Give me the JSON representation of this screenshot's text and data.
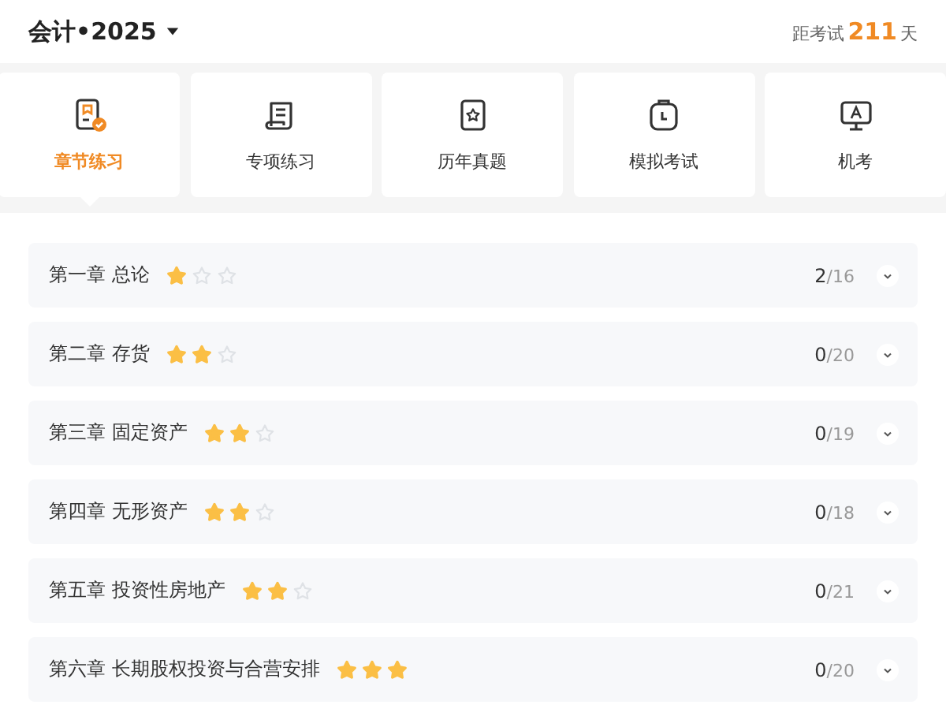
{
  "header": {
    "title": "会计•2025",
    "countdown": {
      "prefix": "距考试",
      "days": "211",
      "suffix": "天"
    }
  },
  "tabs": [
    {
      "label": "章节练习",
      "kind": "chapter",
      "selected": true
    },
    {
      "label": "专项练习",
      "kind": "scroll",
      "selected": false
    },
    {
      "label": "历年真题",
      "kind": "star-card",
      "selected": false
    },
    {
      "label": "模拟考试",
      "kind": "clipboard",
      "selected": false
    },
    {
      "label": "机考",
      "kind": "monitor",
      "selected": false
    }
  ],
  "chapters": [
    {
      "title": "第一章 总论",
      "stars": 1,
      "progress": "**2**/16"
    },
    {
      "title": "第二章 存货",
      "stars": 2,
      "progress": "**0**/20"
    },
    {
      "title": "第三章 固定资产",
      "stars": 2,
      "progress": "**0**/19"
    },
    {
      "title": "第四章 无形资产",
      "stars": 2,
      "progress": "**0**/18"
    },
    {
      "title": "第五章 投资性房地产",
      "stars": 2,
      "progress": "**0**/21"
    },
    {
      "title": "第六章 长期股权投资与合营安排",
      "stars": 3,
      "progress": "**0**/20"
    }
  ]
}
